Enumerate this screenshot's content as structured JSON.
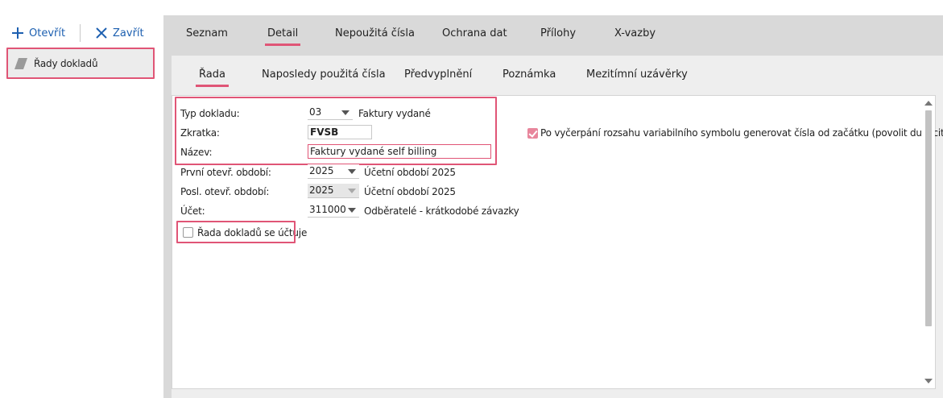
{
  "toolbar": {
    "open_label": "Otevřít",
    "close_label": "Zavřít"
  },
  "sidebar": {
    "items": [
      {
        "label": "Řady dokladů"
      }
    ]
  },
  "main_tabs": [
    "Seznam",
    "Detail",
    "Nepoužitá čísla",
    "Ochrana dat",
    "Přílohy",
    "X-vazby"
  ],
  "main_tab_active": "Detail",
  "sub_tabs": [
    "Řada",
    "Naposledy použitá čísla",
    "Předvyplnění",
    "Poznámka",
    "Mezitímní uzávěrky"
  ],
  "sub_tab_active": "Řada",
  "form": {
    "typ_dokladu": {
      "label": "Typ dokladu:",
      "value": "03",
      "desc": "Faktury vydané"
    },
    "zkratka": {
      "label": "Zkratka:",
      "value": "FVSB"
    },
    "nazev": {
      "label": "Název:",
      "value": "Faktury vydané self billing"
    },
    "prvni_obdobi": {
      "label": "První otevř. období:",
      "value": "2025",
      "desc": "Účetní období 2025"
    },
    "posl_obdobi": {
      "label": "Posl. otevř. období:",
      "value": "2025",
      "desc": "Účetní období 2025"
    },
    "ucet": {
      "label": "Účet:",
      "value": "311000",
      "desc": "Odběratelé - krátkodobé závazky"
    },
    "rada_uctuje": {
      "label": "Řada dokladů se účtuje",
      "checked": false
    },
    "povolit_duplicity": {
      "label": "Po vyčerpání rozsahu variabilního symbolu generovat čísla od začátku (povolit duplicity)",
      "checked": true
    }
  },
  "colors": {
    "accent": "#e05576",
    "link": "#1c5fb0",
    "panel_bg": "#d9d9d9"
  }
}
